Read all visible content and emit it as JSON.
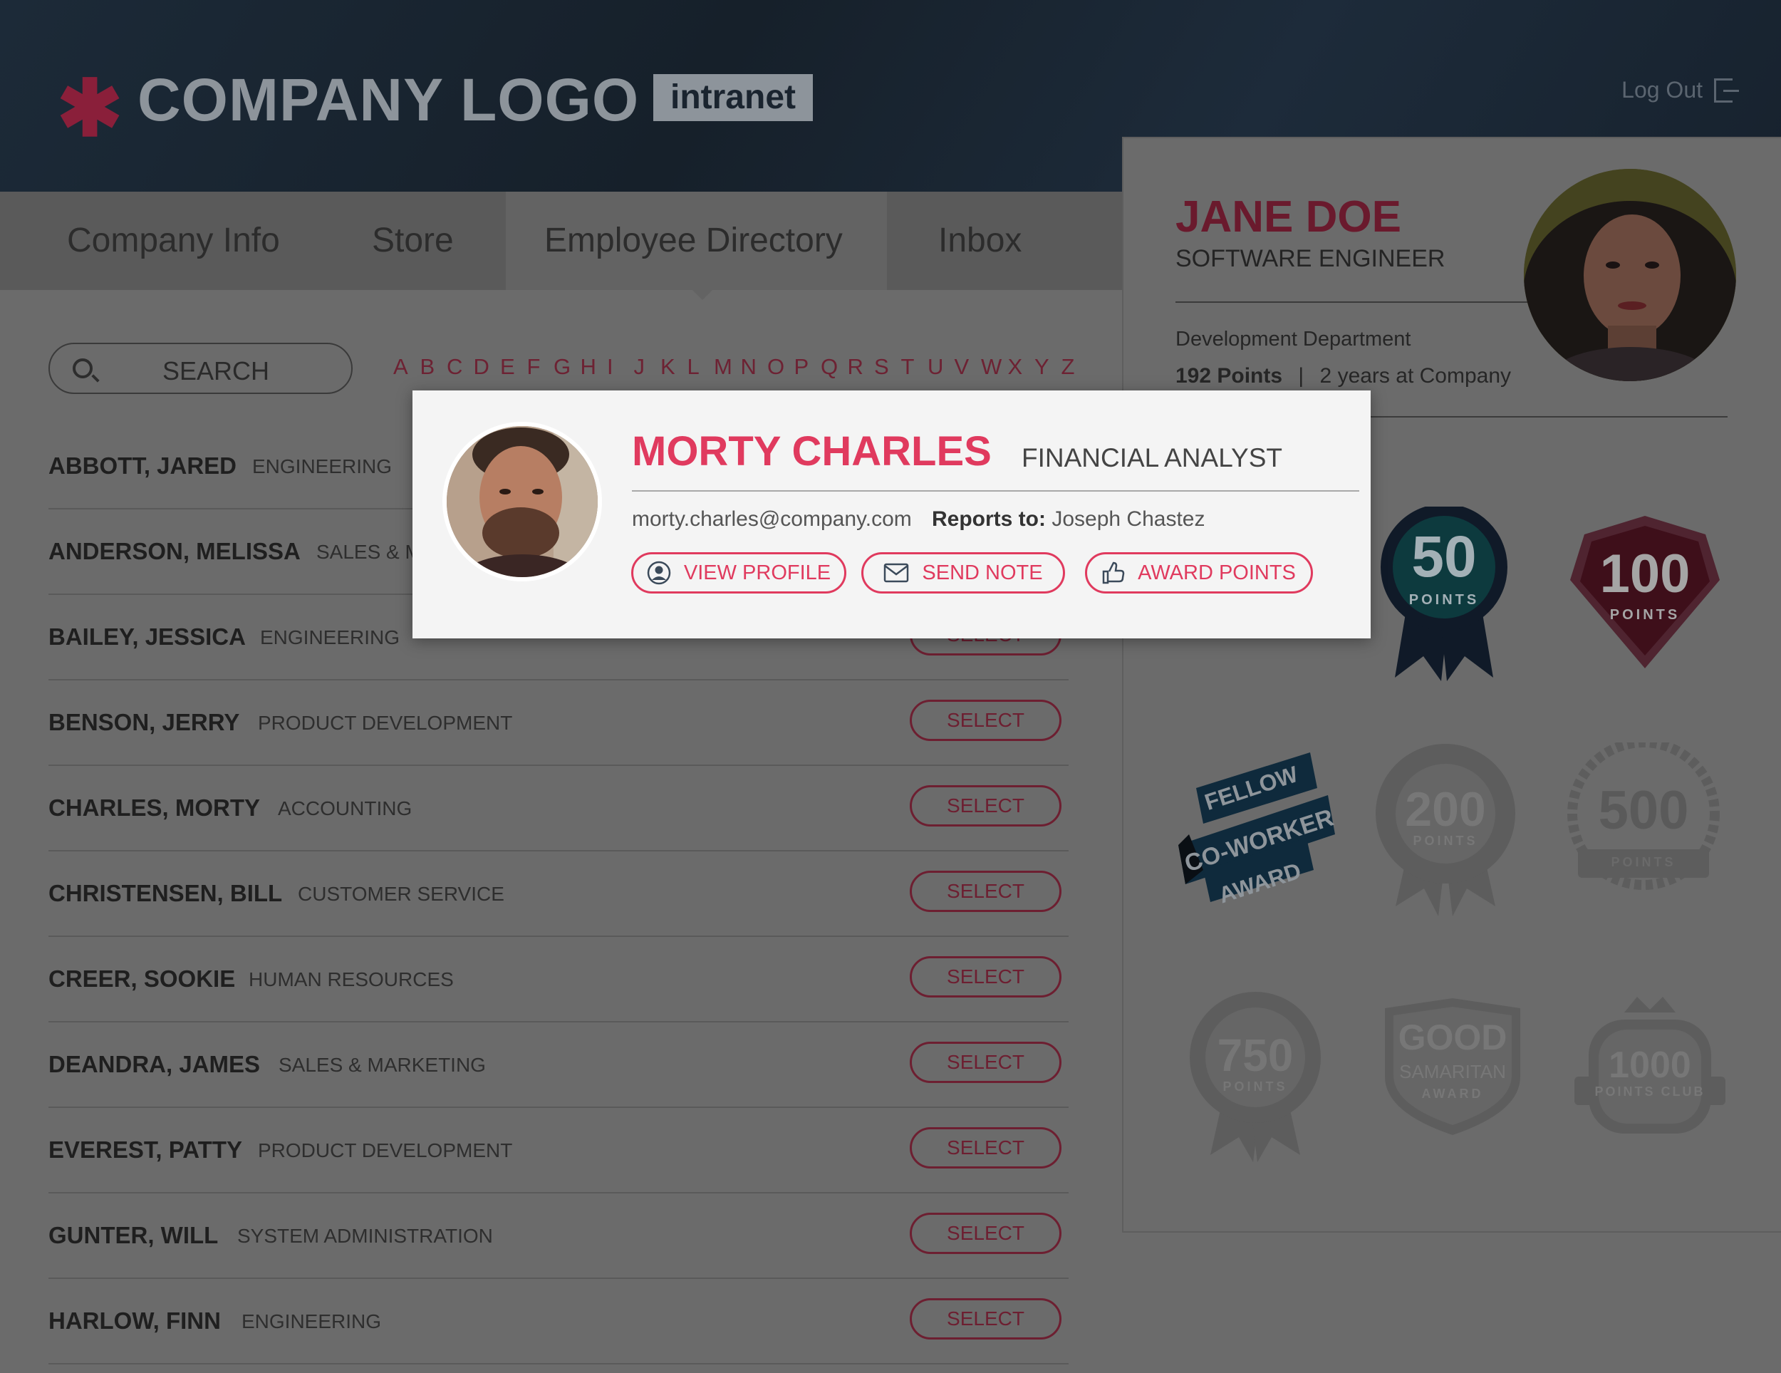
{
  "header": {
    "logo_text": "COMPANY LOGO",
    "logo_badge": "intranet",
    "logout_label": "Log Out"
  },
  "nav": {
    "items": [
      {
        "label": "Company Info",
        "active": false
      },
      {
        "label": "Store",
        "active": false
      },
      {
        "label": "Employee Directory",
        "active": true
      },
      {
        "label": "Inbox",
        "active": false
      }
    ]
  },
  "search": {
    "label": "SEARCH"
  },
  "alphabet": [
    "A",
    "B",
    "C",
    "D",
    "E",
    "F",
    "G",
    "H",
    "I",
    "J",
    "K",
    "L",
    "M",
    "N",
    "O",
    "P",
    "Q",
    "R",
    "S",
    "T",
    "U",
    "V",
    "W",
    "X",
    "Y",
    "Z"
  ],
  "directory": {
    "select_label": "SELECT",
    "rows": [
      {
        "name": "ABBOTT, JARED",
        "dept": "ENGINEERING"
      },
      {
        "name": "ANDERSON, MELISSA",
        "dept": "SALES & M"
      },
      {
        "name": "BAILEY, JESSICA",
        "dept": "ENGINEERING"
      },
      {
        "name": "BENSON, JERRY",
        "dept": "PRODUCT DEVELOPMENT"
      },
      {
        "name": "CHARLES, MORTY",
        "dept": "ACCOUNTING"
      },
      {
        "name": "CHRISTENSEN, BILL",
        "dept": "CUSTOMER SERVICE"
      },
      {
        "name": "CREER, SOOKIE",
        "dept": "HUMAN RESOURCES"
      },
      {
        "name": "DEANDRA, JAMES",
        "dept": "SALES & MARKETING"
      },
      {
        "name": "EVEREST, PATTY",
        "dept": "PRODUCT DEVELOPMENT"
      },
      {
        "name": "GUNTER, WILL",
        "dept": "SYSTEM ADMINISTRATION"
      },
      {
        "name": "HARLOW, FINN",
        "dept": "ENGINEERING"
      }
    ]
  },
  "profile": {
    "name": "JANE DOE",
    "title": "SOFTWARE ENGINEER",
    "department": "Development Department",
    "points": "192 Points",
    "separator": "|",
    "tenure": "2 years at Company"
  },
  "badges": {
    "b50": {
      "num": "50",
      "sub": "POINTS"
    },
    "b100": {
      "num": "100",
      "sub": "POINTS"
    },
    "fellow": {
      "l1": "FELLOW",
      "l2": "CO-WORKER",
      "l3": "AWARD"
    },
    "b200": {
      "num": "200",
      "sub": "POINTS"
    },
    "b500": {
      "num": "500",
      "sub": "POINTS"
    },
    "b750": {
      "num": "750",
      "sub": "POINTS"
    },
    "good": {
      "l1": "GOOD",
      "l2": "SAMARITAN",
      "l3": "AWARD"
    },
    "b1000": {
      "num": "1000",
      "sub": "POINTS CLUB"
    }
  },
  "card": {
    "name": "MORTY CHARLES",
    "title": "FINANCIAL ANALYST",
    "email": "morty.charles@company.com",
    "reports_label": "Reports to:",
    "reports_name": "Joseph Chastez",
    "buttons": {
      "view_profile": "VIEW PROFILE",
      "send_note": "SEND NOTE",
      "award_points": "AWARD POINTS"
    }
  },
  "colors": {
    "accent": "#e03a5e",
    "header_bg": "#16202c",
    "overlay_bg": "#6b6b6b"
  }
}
